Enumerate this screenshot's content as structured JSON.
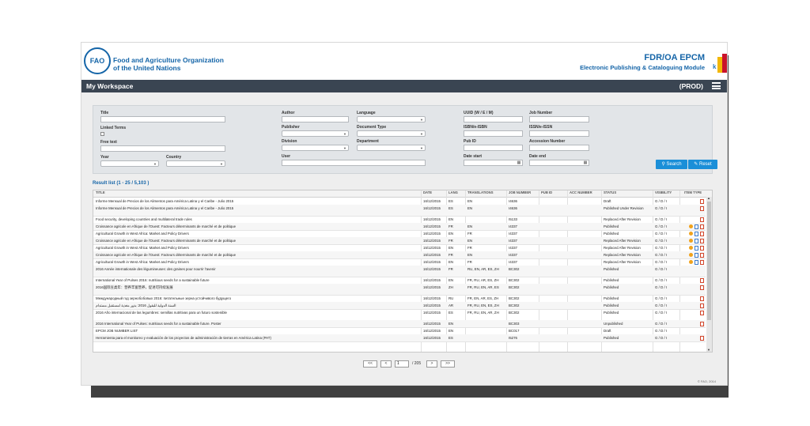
{
  "header": {
    "logo_text": "FAO",
    "org_line1": "Food and Agriculture Organization",
    "org_line2": "of the United Nations",
    "app_title": "FDR/OA EPCM",
    "app_subtitle": "Electronic Publishing & Cataloguing Module",
    "corner_letter": "k"
  },
  "topbar": {
    "title": "My Workspace",
    "environment": "(PROD)",
    "menu_icon": "hamburger-icon"
  },
  "search": {
    "labels": {
      "title": "Title",
      "author": "Author",
      "language": "Language",
      "uuid": "UUID (W / E / M)",
      "job_number": "Job Number",
      "linked_terms": "Linked Terms",
      "publisher": "Publisher",
      "document_type": "Document Type",
      "isbn": "ISBN/e-ISBN",
      "issn": "ISSN/e-ISSN",
      "free_text": "Free text",
      "division": "Division",
      "department": "Department",
      "pub_id": "Pub ID",
      "accession_number": "Accession Number",
      "year": "Year",
      "country": "Country",
      "user": "User",
      "date_start": "Date start",
      "date_end": "Date end"
    },
    "search_button": "Search",
    "reset_button": "Reset"
  },
  "results": {
    "title": "Result list (1 - 25 / 5,103 )",
    "columns": [
      "TITLE",
      "DATE",
      "LANG",
      "TRANSLATIONS",
      "JOB NUMBER",
      "PUB ID",
      "ACC NUMBER",
      "STATUS",
      "VISIBILITY",
      "ITEM TYPE"
    ],
    "rows": [
      {
        "title": "Informe Mensual de Precios de los Alimentos para América Latina y el Caribe - Julio 2015",
        "date": "16/12/2015",
        "lang": "ES",
        "translations": "EN",
        "job": "I4636",
        "pub_id": "",
        "acc": "",
        "status": "Draft",
        "visibility": "G / D / I",
        "icons": [
          "pdf"
        ]
      },
      {
        "title": "Informe Mensual de Precios de los Alimentos para América Latina y el Caribe - Julio 2015",
        "date": "16/12/2015",
        "lang": "ES",
        "translations": "EN",
        "job": "I4636",
        "pub_id": "",
        "acc": "",
        "status": "Published Under Revision",
        "visibility": "G / D / I",
        "icons": [
          "pdf"
        ]
      },
      {
        "title": "Food security, developing countries and multilateral trade rules",
        "date": "16/12/2015",
        "lang": "EN",
        "translations": "",
        "job": "I5133",
        "pub_id": "",
        "acc": "",
        "status": "Replaced After Revision",
        "visibility": "G / D / I",
        "icons": [
          "pdf"
        ]
      },
      {
        "title": "Croissance agricole en Afrique de l'Ouest: Facteurs déterminants de marché et de politique",
        "date": "16/12/2015",
        "lang": "FR",
        "translations": "EN",
        "job": "I4337",
        "pub_id": "",
        "acc": "",
        "status": "Published",
        "visibility": "G / D / I",
        "icons": [
          "rss",
          "doc",
          "pdf"
        ]
      },
      {
        "title": "Agricultural Growth in West Africa: Market and Policy Drivers",
        "date": "16/12/2015",
        "lang": "EN",
        "translations": "FR",
        "job": "I4337",
        "pub_id": "",
        "acc": "",
        "status": "Published",
        "visibility": "G / D / I",
        "icons": [
          "rss",
          "doc",
          "pdf"
        ]
      },
      {
        "title": "Croissance agricole en Afrique de l'Ouest: Facteurs déterminants de marché et de politique",
        "date": "15/12/2015",
        "lang": "FR",
        "translations": "EN",
        "job": "I4337",
        "pub_id": "",
        "acc": "",
        "status": "Replaced After Revision",
        "visibility": "G / D / I",
        "icons": [
          "rss",
          "doc",
          "pdf"
        ]
      },
      {
        "title": "Agricultural Growth in West Africa: Market and Policy Drivers",
        "date": "15/12/2015",
        "lang": "EN",
        "translations": "FR",
        "job": "I4337",
        "pub_id": "",
        "acc": "",
        "status": "Replaced After Revision",
        "visibility": "G / D / I",
        "icons": [
          "rss",
          "doc",
          "pdf"
        ]
      },
      {
        "title": "Croissance agricole en Afrique de l'Ouest: Facteurs déterminants de marché et de politique",
        "date": "15/12/2015",
        "lang": "FR",
        "translations": "EN",
        "job": "I4337",
        "pub_id": "",
        "acc": "",
        "status": "Replaced After Revision",
        "visibility": "G / D / I",
        "icons": [
          "rss",
          "doc",
          "pdf"
        ]
      },
      {
        "title": "Agricultural Growth in West Africa: Market and Policy Drivers",
        "date": "15/12/2015",
        "lang": "EN",
        "translations": "FR",
        "job": "I4337",
        "pub_id": "",
        "acc": "",
        "status": "Replaced After Revision",
        "visibility": "G / D / I",
        "icons": [
          "rss",
          "doc",
          "pdf"
        ]
      },
      {
        "title": "2016 Année internationale des légumineuses: des graines pour nourrir l'avenir",
        "date": "16/12/2015",
        "lang": "FR",
        "translations": "RU, EN, AR, ES, ZH",
        "job": "BC302",
        "pub_id": "",
        "acc": "",
        "status": "Published",
        "visibility": "G / D / I",
        "icons": []
      },
      {
        "title": "International Year of Pulses 2016: nutritious seeds for a sustainable future",
        "date": "16/12/2015",
        "lang": "EN",
        "translations": "FR, RU, AR, ES, ZH",
        "job": "BC302",
        "pub_id": "",
        "acc": "",
        "status": "Published",
        "visibility": "G / D / I",
        "icons": [
          "pdf"
        ]
      },
      {
        "title": "2016国际豆类年：营养丰富营养，促进可持续发展",
        "date": "16/12/2015",
        "lang": "ZH",
        "translations": "FR, RU, EN, AR, ES",
        "job": "BC302",
        "pub_id": "",
        "acc": "",
        "status": "Published",
        "visibility": "G / D / I",
        "icons": [
          "pdf"
        ]
      },
      {
        "title": "Международный год зернобобовых 2016: питательные зерна устойчивого будущего",
        "date": "16/12/2015",
        "lang": "RU",
        "translations": "FR, EN, AR, ES, ZH",
        "job": "BC302",
        "pub_id": "",
        "acc": "",
        "status": "Published",
        "visibility": "G / D / I",
        "icons": [
          "pdf"
        ]
      },
      {
        "title": "السنة الدولية للبقول 2016: بذور مغذية لمستقبل مستدام",
        "date": "16/12/2015",
        "lang": "AR",
        "translations": "FR, RU, EN, ES, ZH",
        "job": "BC302",
        "pub_id": "",
        "acc": "",
        "status": "Published",
        "visibility": "G / D / I",
        "icons": [
          "pdf"
        ]
      },
      {
        "title": "2016 Año internacional de las legumbres: semillas nutritivas para un futuro sostenible",
        "date": "16/12/2015",
        "lang": "ES",
        "translations": "FR, RU, EN, AR, ZH",
        "job": "BC302",
        "pub_id": "",
        "acc": "",
        "status": "Published",
        "visibility": "G / D / I",
        "icons": [
          "pdf"
        ]
      },
      {
        "title": "2016 International Year of Pulses: nutritious seeds for a sustainable future. Poster",
        "date": "16/12/2015",
        "lang": "EN",
        "translations": "",
        "job": "BC303",
        "pub_id": "",
        "acc": "",
        "status": "Unpublished",
        "visibility": "G / D / I",
        "icons": [
          "pdf"
        ]
      },
      {
        "title": "EPCM JOB NUMBER LIST",
        "date": "16/12/2015",
        "lang": "EN",
        "translations": "",
        "job": "BC017",
        "pub_id": "",
        "acc": "",
        "status": "Draft",
        "visibility": "G / D / I",
        "icons": []
      },
      {
        "title": "Herramienta para el monitoreo y evaluación de los proyectos de administración de tierras en América Latina (PAT)",
        "date": "16/12/2015",
        "lang": "ES",
        "translations": "",
        "job": "I5276",
        "pub_id": "",
        "acc": "",
        "status": "Published",
        "visibility": "G / D / I",
        "icons": [
          "pdf"
        ]
      }
    ]
  },
  "pager": {
    "first": "<<",
    "prev": "<",
    "page": "1",
    "total": "/ 205",
    "next": ">",
    "last": ">>"
  },
  "footer": {
    "copyright": "© FAO, 2014"
  }
}
